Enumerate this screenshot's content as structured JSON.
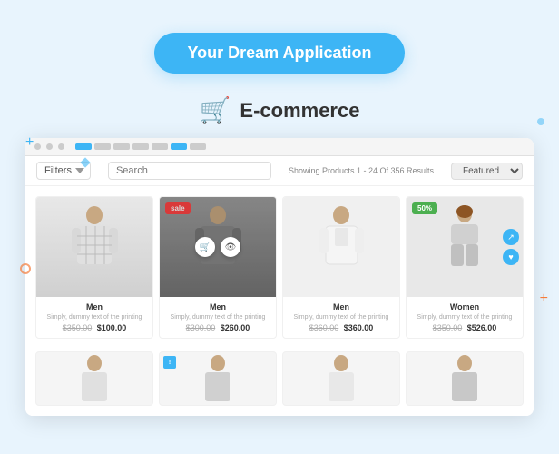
{
  "header": {
    "dream_btn": "Your Dream Application",
    "title": "E-commerce",
    "cart_icon": "🛒"
  },
  "toolbar": {
    "filters_label": "Filters",
    "search_placeholder": "Search",
    "showing_text": "Showing Products 1 - 24 Of 356 Results",
    "featured_label": "Featured"
  },
  "products": [
    {
      "category": "Men",
      "desc": "Simply, dummy text of the printing",
      "price_old": "$350.00",
      "price_new": "$100.00",
      "badge": "",
      "style": "fig1"
    },
    {
      "category": "Men",
      "desc": "Simply, dummy text of the printing",
      "price_old": "$300.00",
      "price_new": "$260.00",
      "badge": "sale",
      "style": "fig2"
    },
    {
      "category": "Men",
      "desc": "Simply, dummy text of the printing",
      "price_old": "$360.00",
      "price_new": "$360.00",
      "badge": "",
      "style": "fig3"
    },
    {
      "category": "Women",
      "desc": "Simply, dummy text of the printing",
      "price_old": "$350.00",
      "price_new": "$526.00",
      "badge": "50%",
      "style": "fig4"
    }
  ],
  "row2_visible": true,
  "decorations": {
    "plus1": "+",
    "plus2": "+",
    "diamond": "◆",
    "circle": "○"
  }
}
